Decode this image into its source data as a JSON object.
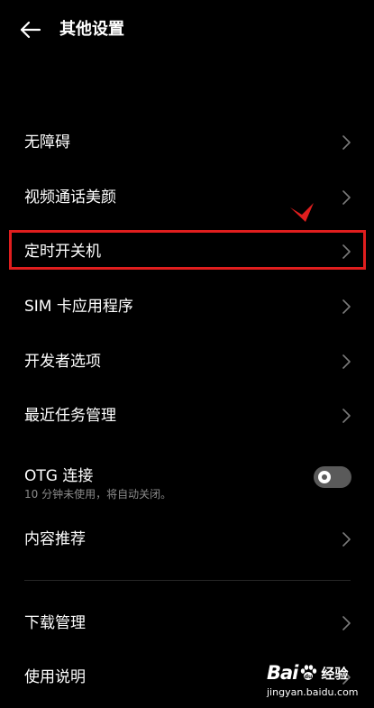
{
  "header": {
    "title": "其他设置",
    "back_icon": "arrow-left-icon"
  },
  "settings": {
    "accessibility": "无障碍",
    "video_call_beauty": "视频通话美颜",
    "scheduled_power": "定时开关机",
    "sim_toolkit": "SIM 卡应用程序",
    "developer_options": "开发者选项",
    "recent_tasks": "最近任务管理",
    "otg": {
      "label": "OTG 连接",
      "subtitle": "10 分钟未使用，将自动关闭。",
      "enabled": false
    },
    "content_recommendation": "内容推荐",
    "download_manager": "下载管理",
    "instructions": "使用说明"
  },
  "annotation": {
    "highlight_color": "#e01e1e",
    "highlighted_item": "定时开关机"
  },
  "watermark": {
    "logo_prefix": "Bai",
    "logo_suffix": "经验",
    "url": "jingyan.baidu.com"
  },
  "colors": {
    "background": "#000000",
    "text": "#ffffff",
    "subtext": "#8a8a8a",
    "toggle_off": "#5a5a5a"
  }
}
